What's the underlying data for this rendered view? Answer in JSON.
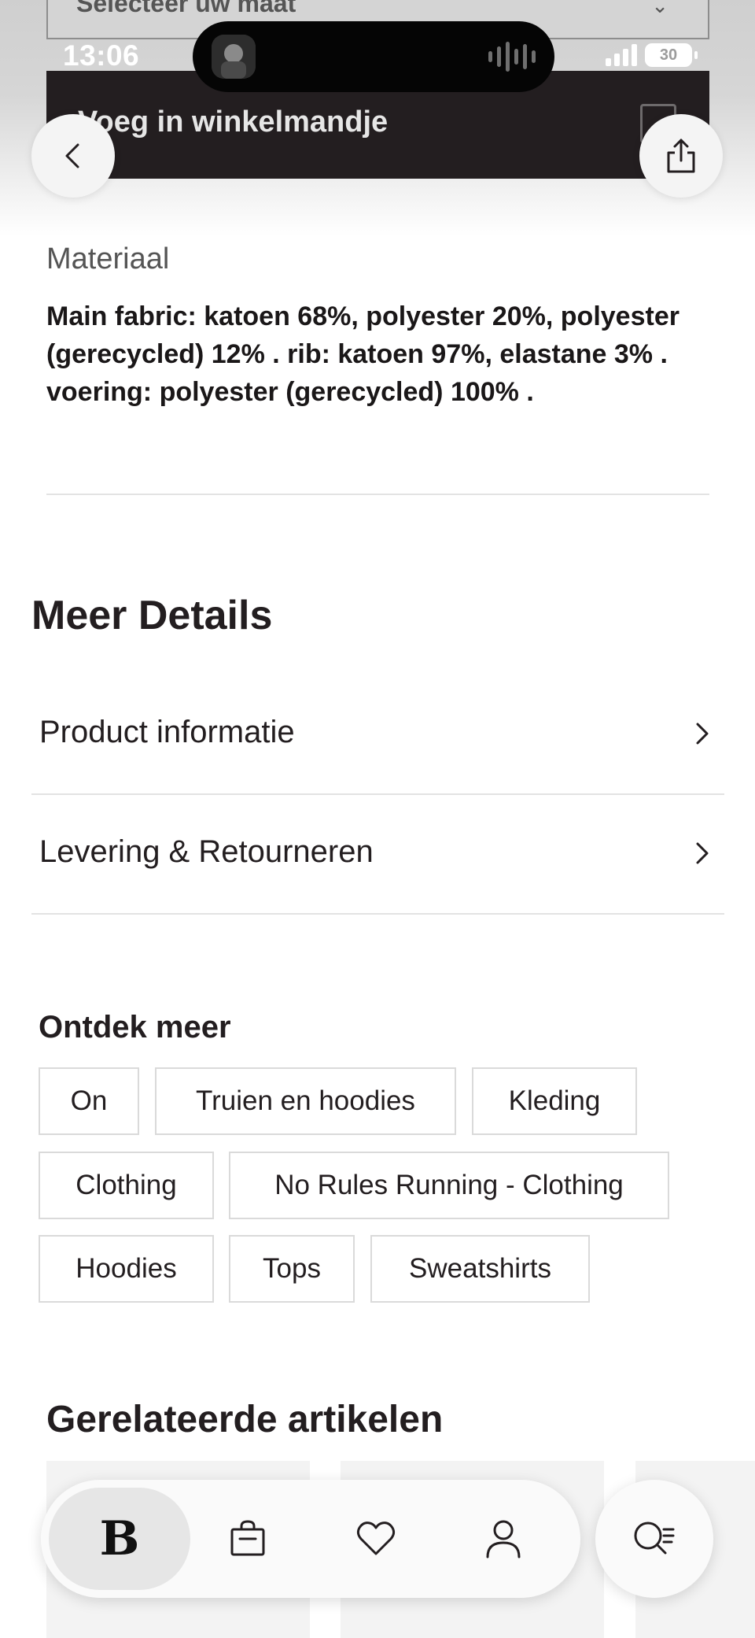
{
  "status_bar": {
    "time": "13:06",
    "battery": "30"
  },
  "size_select": {
    "label": "Selecteer uw maat"
  },
  "cart_bar": {
    "label": "Voeg in winkelmandje"
  },
  "material": {
    "title": "Materiaal",
    "text": "Main fabric: katoen 68%, polyester 20%, polyester (gerecycled) 12% . rib: katoen 97%, elastane 3% . voering: polyester (gerecycled) 100% ."
  },
  "details": {
    "title": "Meer Details",
    "rows": [
      {
        "label": "Product informatie"
      },
      {
        "label": "Levering & Retourneren"
      }
    ]
  },
  "discover": {
    "title": "Ontdek meer",
    "chips": [
      "On",
      "Truien en hoodies",
      "Kleding",
      "Clothing",
      "No Rules Running - Clothing",
      "Hoodies",
      "Tops",
      "Sweatshirts"
    ]
  },
  "related": {
    "title": "Gerelateerde artikelen"
  },
  "bottom_nav": {
    "home_label": "B",
    "items": [
      "bag-icon",
      "heart-icon",
      "account-icon"
    ],
    "search": "search-list-icon"
  }
}
